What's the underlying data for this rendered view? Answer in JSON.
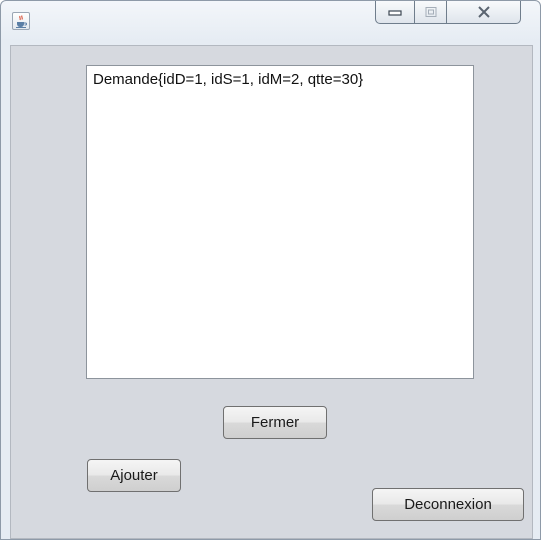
{
  "window": {
    "title": "",
    "icon": "java-cup-icon",
    "controls": [
      "minimize-icon",
      "maximize-icon",
      "close-icon"
    ]
  },
  "list": {
    "items": [
      "Demande{idD=1, idS=1, idM=2, qtte=30}"
    ]
  },
  "buttons": {
    "fermer": "Fermer",
    "ajouter": "Ajouter",
    "deconnexion": "Deconnexion"
  }
}
